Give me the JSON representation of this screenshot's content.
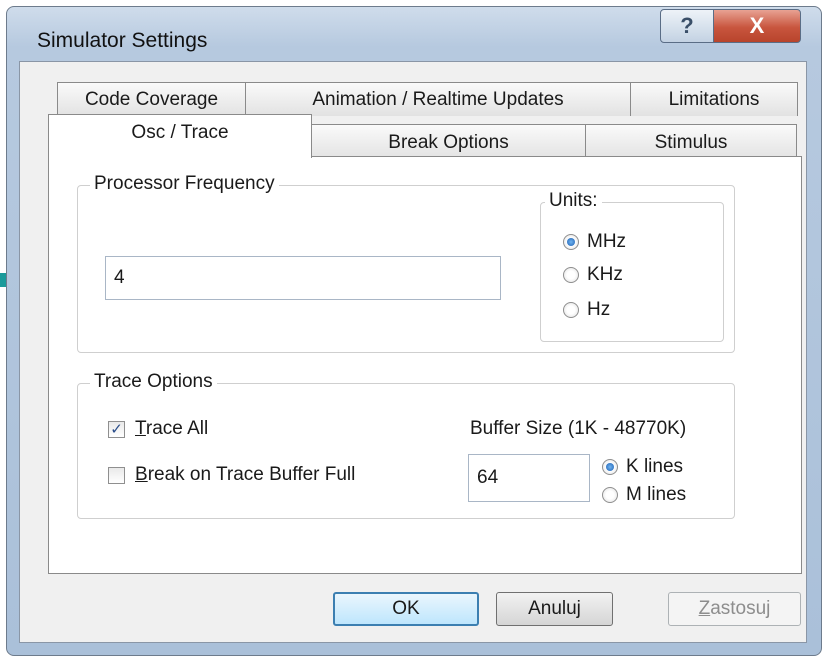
{
  "window": {
    "title": "Simulator Settings",
    "help_glyph": "?",
    "close_glyph": "X"
  },
  "tabs": {
    "back_row": [
      "Code Coverage",
      "Animation / Realtime  Updates",
      "Limitations"
    ],
    "front_row": [
      "Osc / Trace",
      "Break Options",
      "Stimulus"
    ],
    "active": "Osc / Trace"
  },
  "processor": {
    "group_label": "Processor  Frequency",
    "value": "4",
    "units_label": "Units:",
    "units": [
      "MHz",
      "KHz",
      "Hz"
    ],
    "selected_unit": "MHz"
  },
  "trace": {
    "group_label": "Trace Options",
    "trace_all_label": "Trace All",
    "trace_all_checked": true,
    "break_label": "Break on Trace Buffer Full",
    "break_checked": false,
    "buffer_label": "Buffer Size  (1K - 48770K)",
    "buffer_value": "64",
    "line_units": [
      "K lines",
      "M lines"
    ],
    "selected_line_unit": "K lines"
  },
  "buttons": {
    "ok": "OK",
    "cancel": "Anuluj",
    "apply": "Zastosuj"
  },
  "check_glyph": "✓",
  "colors": {
    "arrow": "#1a9a9a",
    "title_bar": "#b6c9df",
    "close_button": "#c8553e"
  }
}
